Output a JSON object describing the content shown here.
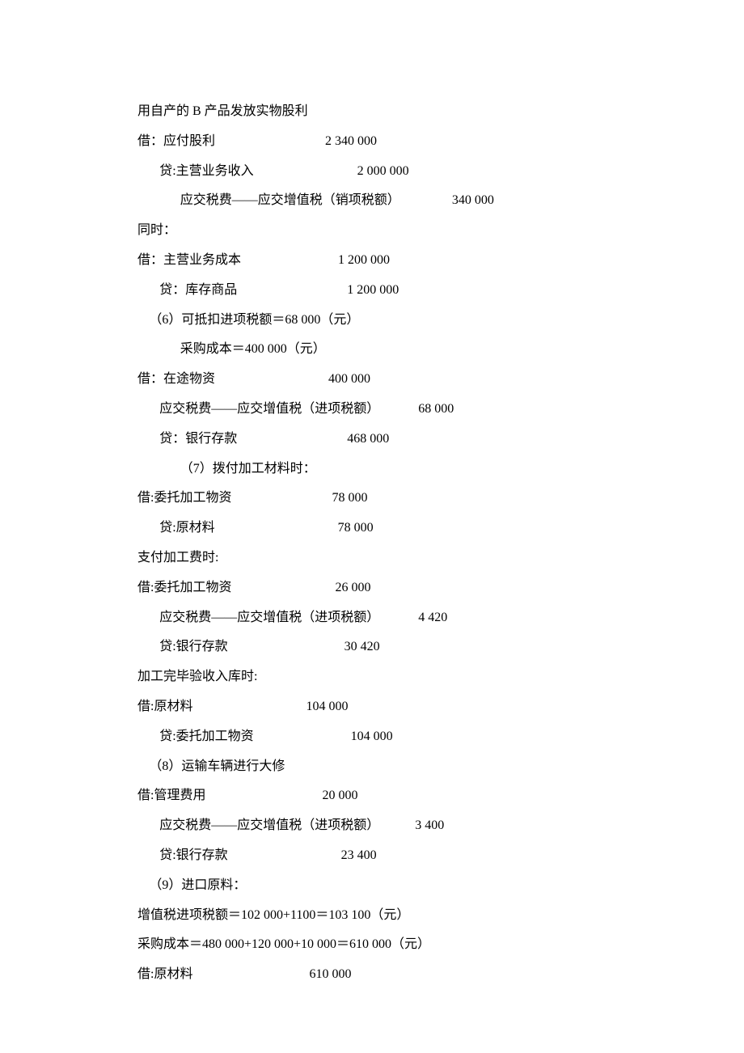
{
  "l1": {
    "text": "用自产的 B 产品发放实物股利"
  },
  "l2": {
    "text": "借：应付股利",
    "val": "                                  2 340 000"
  },
  "l3": {
    "text": "贷:主营业务收入",
    "val": "                                2 000 000"
  },
  "l4": {
    "text": "应交税费——应交增值税（销项税额）",
    "val": "                340 000"
  },
  "l5": {
    "text": "同时："
  },
  "l6": {
    "text": "借：主营业务成本",
    "val": "                              1 200 000"
  },
  "l7": {
    "text": "贷：库存商品",
    "val": "                                  1 200 000"
  },
  "l8": {
    "text": "（6）可抵扣进项税额＝68 000（元）"
  },
  "l9": {
    "text": "采购成本＝400 000（元）"
  },
  "l10": {
    "text": "借：在途物资",
    "val": "                                   400 000"
  },
  "l11": {
    "text": "应交税费——应交增值税（进项税额）",
    "val": "            68 000"
  },
  "l12": {
    "text": "贷：银行存款",
    "val": "                                  468 000"
  },
  "l13": {
    "text": "（7）拨付加工材料时："
  },
  "l14": {
    "text": "借:委托加工物资",
    "val": "                               78 000"
  },
  "l15": {
    "text": "贷:原材料",
    "val": "                                      78 000"
  },
  "l16": {
    "text": "支付加工费时:"
  },
  "l17": {
    "text": "借:委托加工物资",
    "val": "                                26 000"
  },
  "l18": {
    "text": "应交税费——应交增值税（进项税额）",
    "val": "            4 420"
  },
  "l19": {
    "text": "贷:银行存款",
    "val": "                                    30 420"
  },
  "l20": {
    "text": "加工完毕验收入库时:"
  },
  "l21": {
    "text": "借:原材料",
    "val": "                                   104 000"
  },
  "l22": {
    "text": "贷:委托加工物资",
    "val": "                              104 000"
  },
  "l23": {
    "text": "（8）运输车辆进行大修"
  },
  "l24": {
    "text": "借:管理费用",
    "val": "                                    20 000"
  },
  "l25": {
    "text": "应交税费——应交增值税（进项税额）",
    "val": "           3 400"
  },
  "l26": {
    "text": "贷:银行存款",
    "val": "                                   23 400"
  },
  "l27": {
    "text": "（9）进口原料："
  },
  "l28": {
    "text": "增值税进项税额＝102 000+1100＝103 100（元）"
  },
  "l29": {
    "text": "采购成本＝480 000+120 000+10 000＝610 000（元）"
  },
  "l30": {
    "text": "借:原材料",
    "val": "                                    610 000"
  }
}
